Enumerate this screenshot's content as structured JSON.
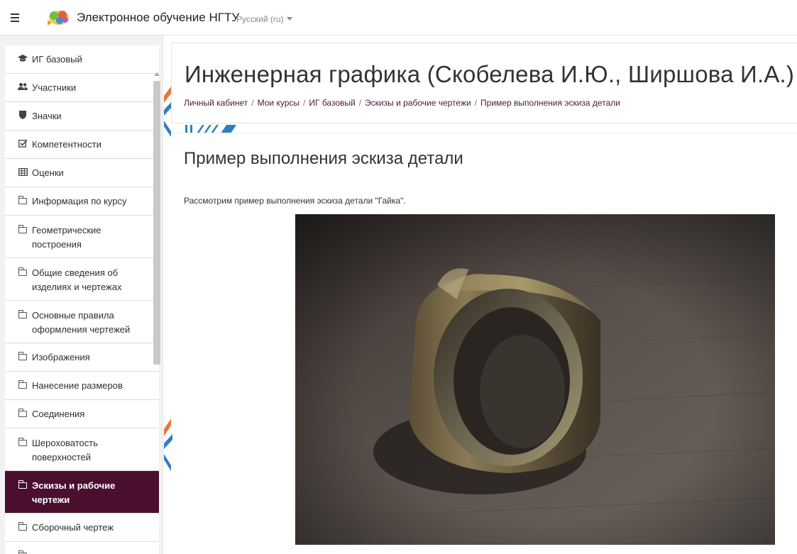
{
  "navbar": {
    "site_name": "Электронное обучение НГТУ",
    "language": "Русский (ru)"
  },
  "drawer": {
    "items": [
      {
        "label": "ИГ базовый",
        "icon": "graduation-cap-icon"
      },
      {
        "label": "Участники",
        "icon": "users-icon"
      },
      {
        "label": "Значки",
        "icon": "shield-icon"
      },
      {
        "label": "Компетентности",
        "icon": "checkbox-icon"
      },
      {
        "label": "Оценки",
        "icon": "table-icon"
      },
      {
        "label": "Информация по курсу",
        "icon": "folder-icon"
      },
      {
        "label": "Геометрические построения",
        "icon": "folder-icon"
      },
      {
        "label": "Общие сведения об изделиях и чертежах",
        "icon": "folder-icon"
      },
      {
        "label": "Основные правила оформления чертежей",
        "icon": "folder-icon"
      },
      {
        "label": "Изображения",
        "icon": "folder-icon"
      },
      {
        "label": "Нанесение размеров",
        "icon": "folder-icon"
      },
      {
        "label": "Соединения",
        "icon": "folder-icon"
      },
      {
        "label": "Шероховатость поверхностей",
        "icon": "folder-icon"
      },
      {
        "label": "Эскизы и рабочие чертежи",
        "icon": "folder-icon",
        "active": true
      },
      {
        "label": "Сборочный чертеж",
        "icon": "folder-icon"
      }
    ]
  },
  "header": {
    "title": "Инженерная графика (Скобелева И.Ю., Ширшова И.А.)",
    "breadcrumb": [
      "Личный кабинет",
      "Мои курсы",
      "ИГ базовый",
      "Эскизы и рабочие чертежи",
      "Пример выполнения эскиза детали"
    ]
  },
  "main": {
    "section_title": "Пример выполнения эскиза детали",
    "intro": "Рассмотрим пример выполнения эскиза детали \"Гайка\"."
  },
  "colors": {
    "active_item": "#4a0e2e",
    "breadcrumb_link": "#4a1a33",
    "accent_orange": "#e07a3c",
    "accent_blue": "#2f7fc1"
  }
}
